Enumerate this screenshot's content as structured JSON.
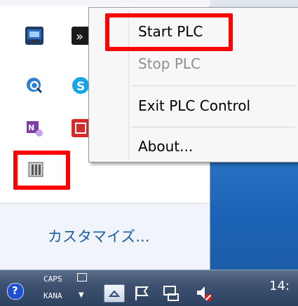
{
  "context_menu": {
    "items": [
      {
        "label": "Start PLC",
        "enabled": true
      },
      {
        "label": "Stop PLC",
        "enabled": false
      },
      {
        "label": "Exit PLC Control",
        "enabled": true
      },
      {
        "label": "About...",
        "enabled": true
      }
    ]
  },
  "tray_panel": {
    "customize_link": "カスタマイズ...",
    "icons": [
      "network-monitor-icon",
      "media-icon",
      "search-app-icon",
      "skype-icon",
      "onenote-icon",
      "red-app-icon",
      "plc-control-icon"
    ]
  },
  "taskbar": {
    "caps": "CAPS",
    "kana": "KANA",
    "clock": "14:"
  },
  "colors": {
    "highlight": "#ff0000",
    "link": "#1d5fa6",
    "menu_bg": "#f7f7f7",
    "disabled_text": "#8e8e8e"
  }
}
